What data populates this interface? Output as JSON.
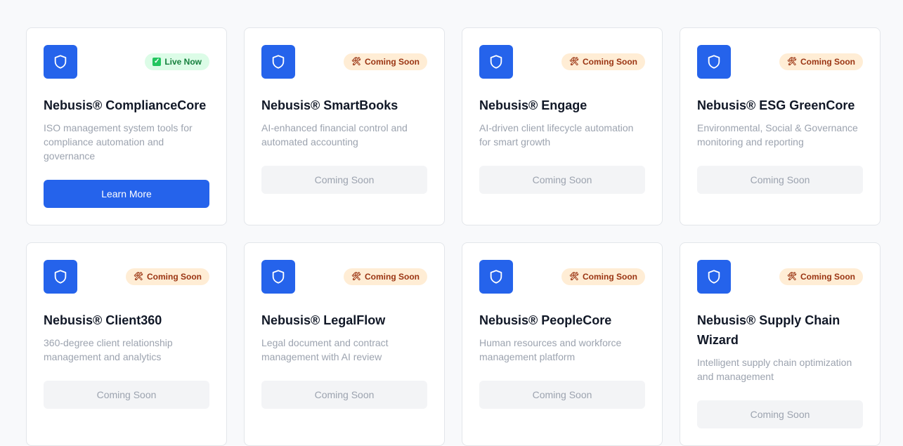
{
  "cards": [
    {
      "title": "Nebusis® ComplianceCore",
      "description": "ISO management system tools for compliance automation and governance",
      "badge": "Live Now",
      "badge_icon": "check-box-icon",
      "button": "Learn More"
    },
    {
      "title": "Nebusis® SmartBooks",
      "description": "AI-enhanced financial control and automated accounting",
      "badge": "Coming Soon",
      "badge_icon": "hammer-wrench-icon",
      "button": "Coming Soon"
    },
    {
      "title": "Nebusis® Engage",
      "description": "AI-driven client lifecycle automation for smart growth",
      "badge": "Coming Soon",
      "badge_icon": "hammer-wrench-icon",
      "button": "Coming Soon"
    },
    {
      "title": "Nebusis® ESG GreenCore",
      "description": "Environmental, Social & Governance monitoring and reporting",
      "badge": "Coming Soon",
      "badge_icon": "hammer-wrench-icon",
      "button": "Coming Soon"
    },
    {
      "title": "Nebusis® Client360",
      "description": "360-degree client relationship management and analytics",
      "badge": "Coming Soon",
      "badge_icon": "hammer-wrench-icon",
      "button": "Coming Soon"
    },
    {
      "title": "Nebusis® LegalFlow",
      "description": "Legal document and contract management with AI review",
      "badge": "Coming Soon",
      "badge_icon": "hammer-wrench-icon",
      "button": "Coming Soon"
    },
    {
      "title": "Nebusis® PeopleCore",
      "description": "Human resources and workforce management platform",
      "badge": "Coming Soon",
      "badge_icon": "hammer-wrench-icon",
      "button": "Coming Soon"
    },
    {
      "title": "Nebusis® Supply Chain Wizard",
      "description": "Intelligent supply chain optimization and management",
      "badge": "Coming Soon",
      "badge_icon": "hammer-wrench-icon",
      "button": "Coming Soon"
    }
  ],
  "colors": {
    "accent": "#2563eb",
    "live_badge_bg": "#dcfce7",
    "live_badge_text": "#15803d",
    "soon_badge_bg": "#ffedd5",
    "soon_badge_text": "#9a3412",
    "disabled_button_bg": "#f3f4f6"
  }
}
